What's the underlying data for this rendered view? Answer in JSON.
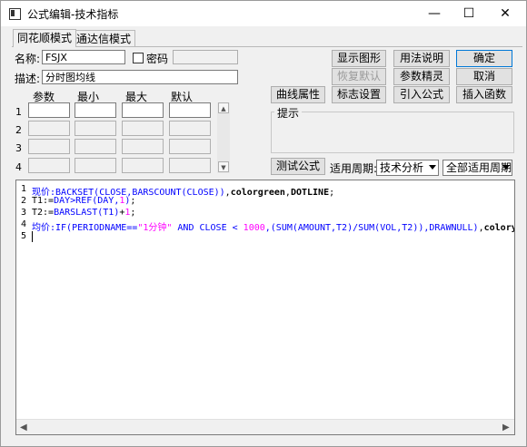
{
  "window": {
    "title": "公式编辑-技术指标"
  },
  "tabs": [
    {
      "label": "同花顺模式"
    },
    {
      "label": "通达信模式"
    }
  ],
  "form": {
    "name_label": "名称:",
    "name_value": "FSJX",
    "password_label": "密码",
    "desc_label": "描述:",
    "desc_value": "分时图均线"
  },
  "buttons": {
    "show_graph": "显示图形",
    "usage": "用法说明",
    "ok": "确定",
    "restore_default": "恢复默认",
    "param_wizard": "参数精灵",
    "cancel": "取消",
    "curve_props": "曲线属性",
    "marker_settings": "标志设置",
    "import_formula": "引入公式",
    "insert_function": "插入函数",
    "test_formula": "测试公式"
  },
  "params": {
    "headers": [
      "参数",
      "最小",
      "最大",
      "默认"
    ],
    "rows": [
      "1",
      "2",
      "3",
      "4"
    ]
  },
  "hint": {
    "label": "提示"
  },
  "period": {
    "label": "适用周期:",
    "type_value": "技术分析",
    "period_value": "全部适用周期"
  },
  "editor": {
    "line_numbers": [
      "1",
      "2",
      "3",
      "4",
      "5"
    ]
  },
  "colors": {
    "accent": "#0078d7",
    "keyword": "#0000ff",
    "number": "#ff00ff"
  }
}
